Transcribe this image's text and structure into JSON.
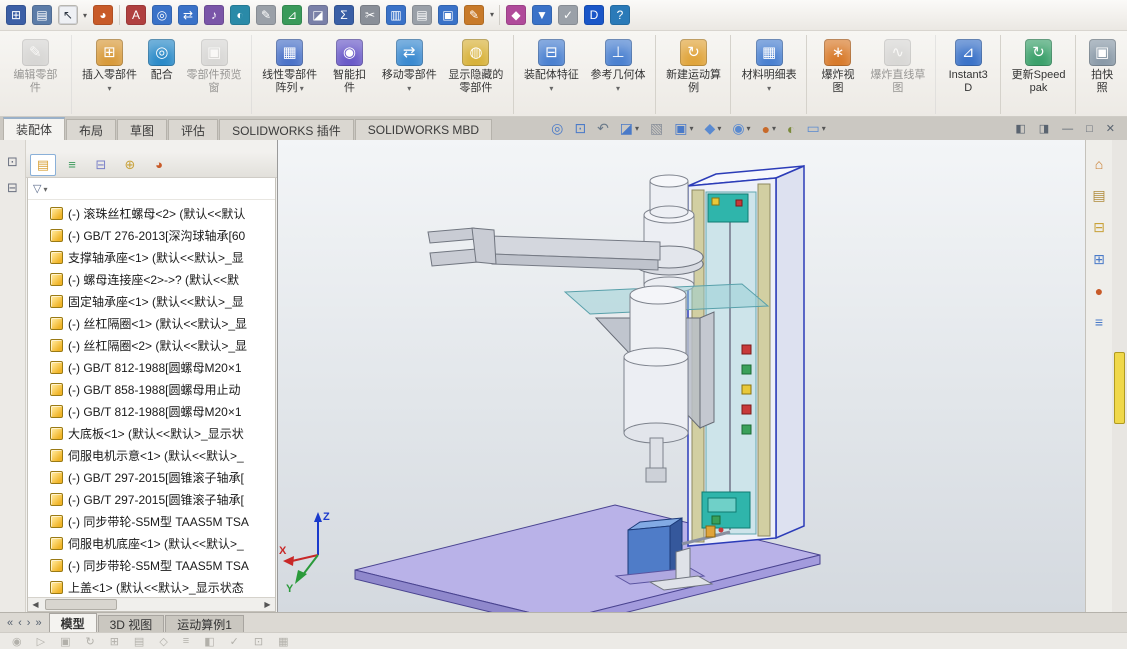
{
  "quick_access_toolbar": {
    "icons": [
      {
        "name": "file-window-icon",
        "glyph": "⊞",
        "color": "#3c5fa6"
      },
      {
        "name": "save-icon",
        "glyph": "▤",
        "color": "#5c7ca8"
      },
      {
        "name": "select-arrow-icon",
        "glyph": "↖",
        "light": true,
        "dropdown": true
      },
      {
        "name": "render-tools-icon",
        "glyph": "◕",
        "color": "#c85a28"
      },
      {
        "sep": true
      },
      {
        "name": "spell-check-icon",
        "glyph": "A",
        "color": "#b04040"
      },
      {
        "name": "magnified-selection-icon",
        "glyph": "◎",
        "color": "#3a72c8"
      },
      {
        "name": "find-replace-icon",
        "glyph": "⇄",
        "color": "#3a72c8"
      },
      {
        "name": "design-journal-icon",
        "glyph": "♪",
        "color": "#7a55a8"
      },
      {
        "name": "web-help-icon",
        "glyph": "◐",
        "color": "#2a8aa8"
      },
      {
        "name": "markup-icon",
        "glyph": "✎",
        "color": "#9aa0a8"
      },
      {
        "name": "measure-icon",
        "glyph": "⊿",
        "color": "#3a9a5a"
      },
      {
        "name": "section-properties-icon",
        "glyph": "◪",
        "color": "#7a80a8"
      },
      {
        "name": "equations-icon",
        "glyph": "Σ",
        "color": "#3a5fa6"
      },
      {
        "name": "curve-tools-icon",
        "glyph": "✂",
        "color": "#8a8f98"
      },
      {
        "name": "mass-properties-icon",
        "glyph": "▥",
        "color": "#3a72c8"
      },
      {
        "name": "performance-evaluation-icon",
        "glyph": "▤",
        "color": "#9aa0a8"
      },
      {
        "name": "copy-settings-icon",
        "glyph": "▣",
        "color": "#3a72c8"
      },
      {
        "name": "edit-appearance-qat-icon",
        "glyph": "✎",
        "color": "#c87a2a",
        "dropdown": true
      },
      {
        "sep": true
      },
      {
        "name": "magic-tool-icon",
        "glyph": "◆",
        "color": "#b04a9a"
      },
      {
        "name": "selection-filter-icon",
        "glyph": "▼",
        "color": "#3a72c8"
      },
      {
        "name": "verify-icon",
        "glyph": "✓",
        "color": "#9aa0a8"
      },
      {
        "name": "user-account-icon",
        "glyph": "D",
        "color": "#1a56c8"
      },
      {
        "name": "help-icon",
        "glyph": "?",
        "color": "#2a7ab8"
      }
    ]
  },
  "ribbon": {
    "buttons": [
      {
        "name": "edit-component-button",
        "label": "编辑零部件",
        "glyph": "✎",
        "color": "#c8b89a",
        "disabled": true,
        "sep_after": true
      },
      {
        "name": "insert-components-button",
        "label": "插入零部件",
        "glyph": "⊞",
        "color": "#d89a3a",
        "dropdown": true
      },
      {
        "name": "mate-button",
        "label": "配合",
        "glyph": "◎",
        "color": "#2a8ac8"
      },
      {
        "name": "component-preview-window-button",
        "label": "零部件预览窗",
        "glyph": "▣",
        "color": "#b8bcc4",
        "disabled": true,
        "sep_after": true
      },
      {
        "name": "linear-component-pattern-button",
        "label": "线性零部件阵列",
        "glyph": "▦",
        "color": "#4a72c8",
        "dropdown": true
      },
      {
        "name": "smart-fasteners-button",
        "label": "智能扣件",
        "glyph": "◉",
        "color": "#6a5ac8"
      },
      {
        "name": "move-component-button",
        "label": "移动零部件",
        "glyph": "⇄",
        "color": "#3a8ad0",
        "dropdown": true
      },
      {
        "name": "show-hidden-components-button",
        "label": "显示隐藏的零部件",
        "glyph": "◍",
        "color": "#d8b23a",
        "sep_after": true
      },
      {
        "name": "assembly-features-button",
        "label": "装配体特征",
        "glyph": "⊟",
        "color": "#4a80d0",
        "dropdown": true
      },
      {
        "name": "reference-geometry-button",
        "label": "参考几何体",
        "glyph": "⊥",
        "color": "#4a80d0",
        "dropdown": true,
        "sep_after": true
      },
      {
        "name": "new-motion-study-button",
        "label": "新建运动算例",
        "glyph": "↻",
        "color": "#e0a43a",
        "sep_after": true
      },
      {
        "name": "bill-of-materials-button",
        "label": "材料明细表",
        "glyph": "▦",
        "color": "#4a80d0",
        "dropdown": true,
        "sep_after": true
      },
      {
        "name": "exploded-view-button",
        "label": "爆炸视图",
        "glyph": "∗",
        "color": "#d87a2a"
      },
      {
        "name": "explode-line-sketch-button",
        "label": "爆炸直线草图",
        "glyph": "∿",
        "color": "#b8bcc4",
        "disabled": true,
        "sep_after": true
      },
      {
        "name": "instant3d-button",
        "label": "Instant3D",
        "glyph": "⊿",
        "color": "#3a72c8",
        "sep_after": true
      },
      {
        "name": "update-speedpak-button",
        "label": "更新Speedpak",
        "glyph": "↻",
        "color": "#3aa06a",
        "sep_after": true
      },
      {
        "name": "take-snapshot-button",
        "label": "拍快照",
        "glyph": "▣",
        "color": "#8a9aa8"
      }
    ]
  },
  "command_tabs": [
    {
      "name": "tab-assembly",
      "label": "装配体",
      "active": true
    },
    {
      "name": "tab-layout",
      "label": "布局"
    },
    {
      "name": "tab-sketch",
      "label": "草图"
    },
    {
      "name": "tab-evaluate",
      "label": "评估"
    },
    {
      "name": "tab-solidworks-addins",
      "label": "SOLIDWORKS 插件"
    },
    {
      "name": "tab-solidworks-mbd",
      "label": "SOLIDWORKS MBD"
    }
  ],
  "heads_up_toolbar": {
    "icons": [
      {
        "name": "zoom-fit-icon",
        "glyph": "◎",
        "color": "#4a7ac8"
      },
      {
        "name": "zoom-area-icon",
        "glyph": "⊡",
        "color": "#4a7ac8"
      },
      {
        "name": "previous-view-icon",
        "glyph": "↶",
        "color": "#6a7a8a"
      },
      {
        "name": "section-view-icon",
        "glyph": "◪",
        "color": "#4a7ac8",
        "dropdown": true
      },
      {
        "name": "view-sketches-icon",
        "glyph": "▧",
        "color": "#8a909a"
      },
      {
        "name": "view-orientation-icon",
        "glyph": "▣",
        "color": "#4a7ac8",
        "dropdown": true
      },
      {
        "name": "display-style-icon",
        "glyph": "◆",
        "color": "#5a8ad0",
        "dropdown": true
      },
      {
        "name": "hide-show-items-icon",
        "glyph": "◉",
        "color": "#5a8ad0",
        "dropdown": true
      },
      {
        "name": "edit-appearance-icon",
        "glyph": "●",
        "color": "#c86a2a",
        "dropdown": true
      },
      {
        "name": "apply-scene-icon",
        "glyph": "◐",
        "color": "#7a8a3a"
      },
      {
        "name": "view-settings-icon",
        "glyph": "▭",
        "color": "#5a8ad0",
        "dropdown": true
      }
    ]
  },
  "window_controls": {
    "icons": [
      {
        "name": "pane-left-icon",
        "glyph": "◧"
      },
      {
        "name": "pane-split-icon",
        "glyph": "◨"
      },
      {
        "name": "doc-minimize-icon",
        "glyph": "—"
      },
      {
        "name": "doc-restore-icon",
        "glyph": "□"
      },
      {
        "name": "doc-close-icon",
        "glyph": "✕"
      }
    ]
  },
  "left_strip": {
    "icons": [
      {
        "name": "display-pane-toggle-icon",
        "glyph": "⊡"
      },
      {
        "name": "feature-pane-toggle-icon",
        "glyph": "⊟"
      }
    ]
  },
  "panel": {
    "tabs": [
      {
        "name": "featuremanager-tab-icon",
        "glyph": "▤",
        "color": "#d8a23a",
        "active": true
      },
      {
        "name": "propertymanager-tab-icon",
        "glyph": "≡",
        "color": "#3a9a5a"
      },
      {
        "name": "configurationmanager-tab-icon",
        "glyph": "⊟",
        "color": "#7a80c8"
      },
      {
        "name": "dimxpertmanager-tab-icon",
        "glyph": "⊕",
        "color": "#c8a23a"
      },
      {
        "name": "displaymanager-tab-icon",
        "glyph": "◕",
        "color": "#c85a28"
      }
    ],
    "expand_glyph": "›",
    "filter": {
      "glyph": "▽"
    }
  },
  "feature_tree": {
    "items": [
      {
        "text": "(-) 滚珠丝杠螺母<2> (默认<<默认"
      },
      {
        "text": "(-) GB/T 276-2013[深沟球轴承[60"
      },
      {
        "text": "支撑轴承座<1> (默认<<默认>_显"
      },
      {
        "text": "(-) 螺母连接座<2>->? (默认<<默"
      },
      {
        "text": "固定轴承座<1> (默认<<默认>_显"
      },
      {
        "text": "(-) 丝杠隔圈<1> (默认<<默认>_显"
      },
      {
        "text": "(-) 丝杠隔圈<2> (默认<<默认>_显"
      },
      {
        "text": "(-) GB/T 812-1988[圆螺母M20×1"
      },
      {
        "text": "(-) GB/T 858-1988[圆螺母用止动"
      },
      {
        "text": "(-) GB/T 812-1988[圆螺母M20×1"
      },
      {
        "text": "大底板<1> (默认<<默认>_显示状"
      },
      {
        "text": "伺服电机示意<1> (默认<<默认>_"
      },
      {
        "text": "(-) GB/T 297-2015[圆锥滚子轴承["
      },
      {
        "text": "(-) GB/T 297-2015[圆锥滚子轴承["
      },
      {
        "text": "(-) 同步带轮-S5M型 TAAS5M TSA"
      },
      {
        "text": "伺服电机底座<1> (默认<<默认>_"
      },
      {
        "text": "(-) 同步带轮-S5M型 TAAS5M TSA"
      },
      {
        "text": "上盖<1> (默认<<默认>_显示状态"
      }
    ]
  },
  "viewport": {
    "triad": {
      "x": "X",
      "y": "Y",
      "z": "Z"
    },
    "colors": {
      "base": "#b9b2e8",
      "base_side": "#8f88cc",
      "column_outline": "#2c3cb8",
      "rail": "#d2cfa2",
      "carriage": "#2fb5ab",
      "motor": "#4f7cc8",
      "arm": "#d4d7de"
    }
  },
  "task_pane": {
    "icons": [
      {
        "name": "solidworks-resources-icon",
        "glyph": "⌂",
        "color": "#c87a2a"
      },
      {
        "name": "design-library-icon",
        "glyph": "▤",
        "color": "#b08a3a"
      },
      {
        "name": "file-explorer-icon",
        "glyph": "⊟",
        "color": "#c8a23a"
      },
      {
        "name": "view-palette-icon",
        "glyph": "⊞",
        "color": "#4a7ac8"
      },
      {
        "name": "appearances-scenes-icon",
        "glyph": "●",
        "color": "#c85a28"
      },
      {
        "name": "custom-properties-icon",
        "glyph": "≡",
        "color": "#4a7ac8"
      }
    ]
  },
  "bottom_bar": {
    "nav_icons": [
      {
        "name": "first-tab-icon",
        "glyph": "«"
      },
      {
        "name": "prev-tab-icon",
        "glyph": "‹"
      },
      {
        "name": "next-tab-icon",
        "glyph": "›"
      },
      {
        "name": "last-tab-icon",
        "glyph": "»"
      }
    ],
    "tabs": [
      {
        "name": "tab-model",
        "label": "模型",
        "active": true
      },
      {
        "name": "tab-3d-views",
        "label": "3D 视图"
      },
      {
        "name": "tab-motion-study-1",
        "label": "运动算例1"
      }
    ]
  },
  "status_bar": {
    "icons": [
      {
        "name": "status-tool-icon",
        "glyph": "◉"
      },
      {
        "name": "status-tool-icon",
        "glyph": "▷"
      },
      {
        "name": "status-tool-icon",
        "glyph": "▣"
      },
      {
        "name": "status-tool-icon",
        "glyph": "↻"
      },
      {
        "name": "status-tool-icon",
        "glyph": "⊞"
      },
      {
        "name": "status-tool-icon",
        "glyph": "▤"
      },
      {
        "name": "status-tool-icon",
        "glyph": "◇"
      },
      {
        "name": "status-tool-icon",
        "glyph": "≡"
      },
      {
        "name": "status-tool-icon",
        "glyph": "◧"
      },
      {
        "name": "status-tool-icon",
        "glyph": "✓"
      },
      {
        "name": "status-tool-icon",
        "glyph": "⊡"
      },
      {
        "name": "status-tool-icon",
        "glyph": "▦"
      }
    ]
  }
}
